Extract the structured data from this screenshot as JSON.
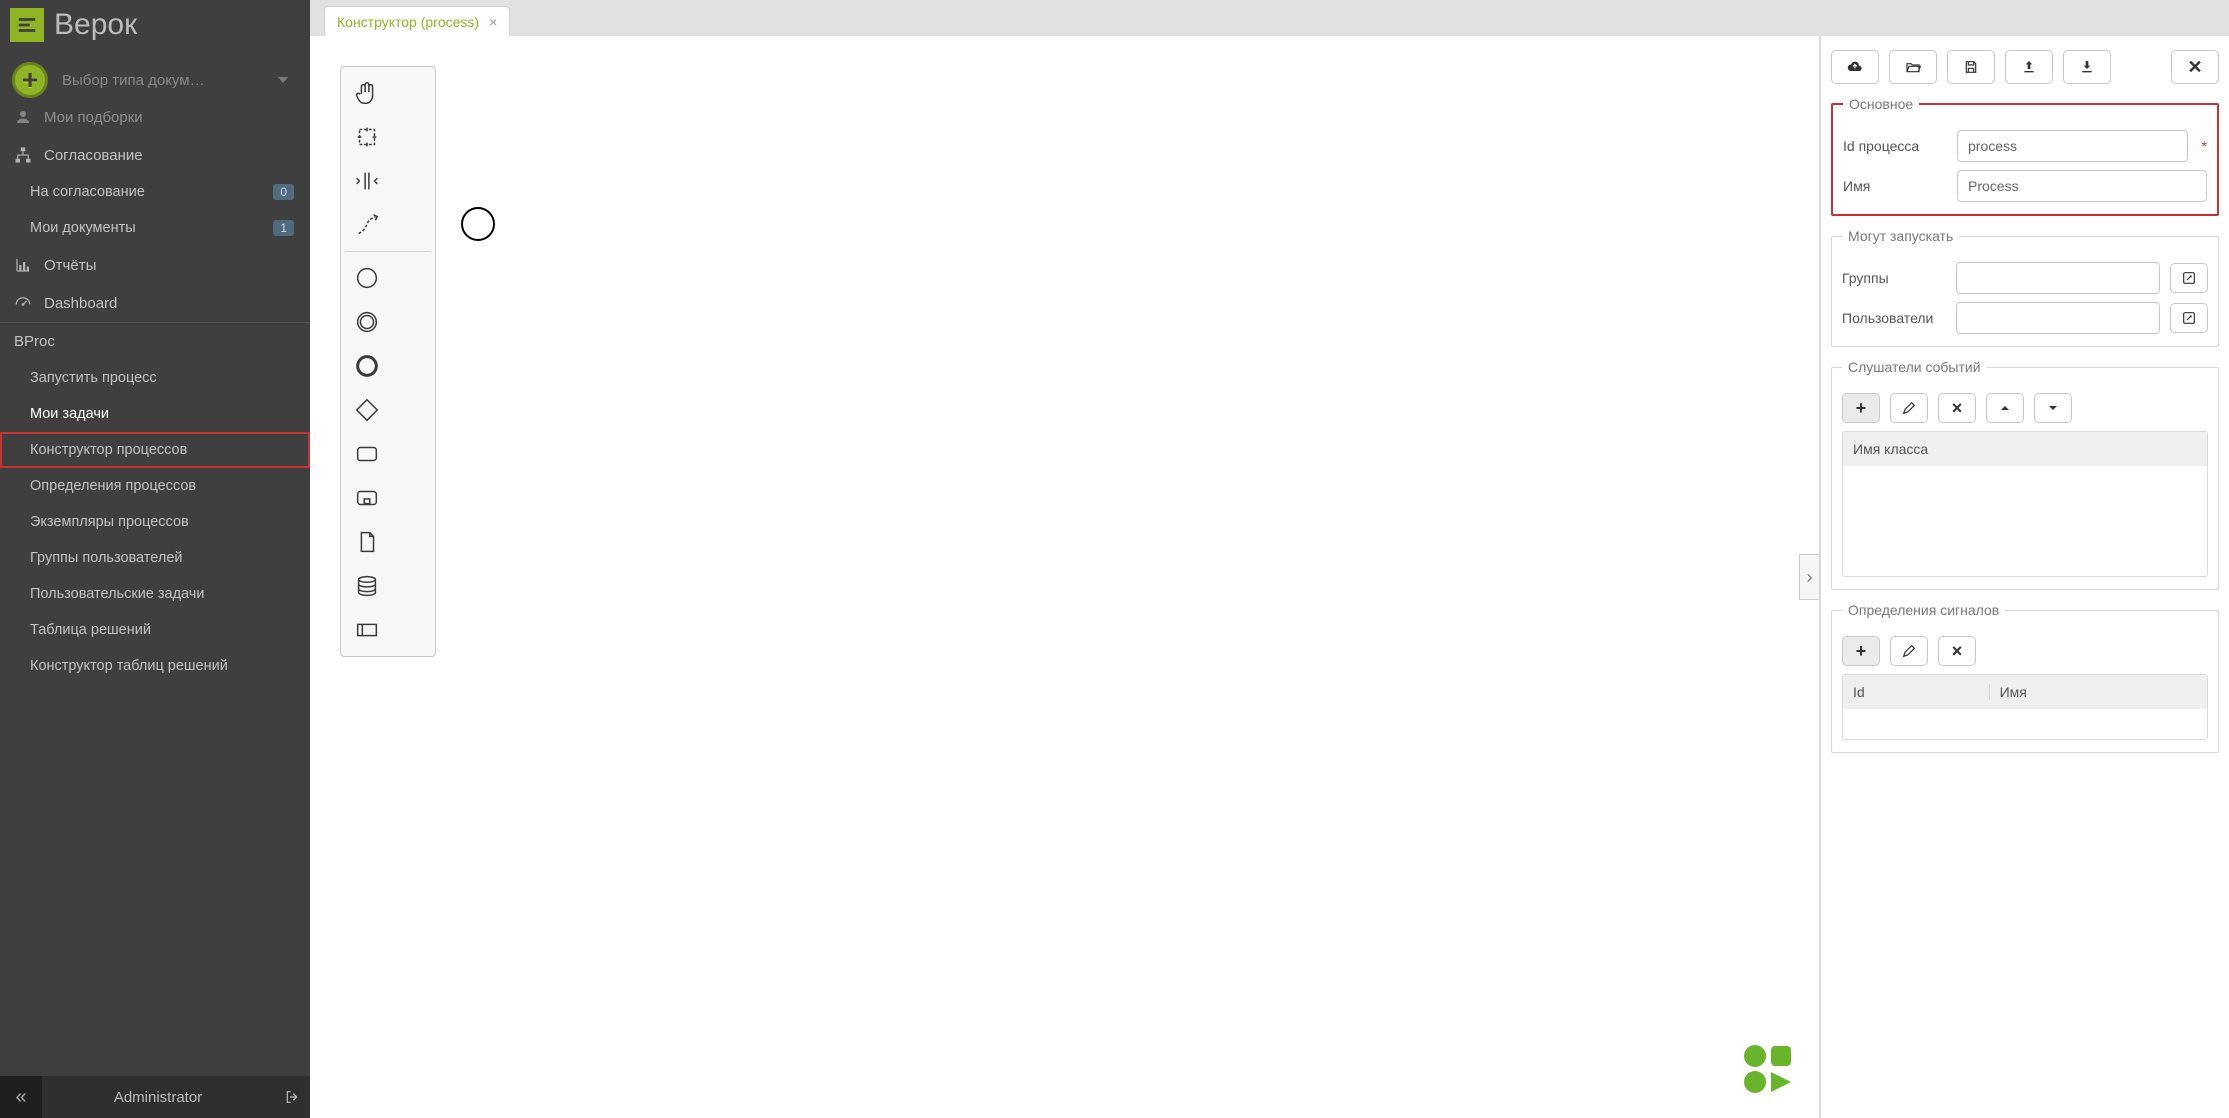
{
  "app": {
    "name": "Верок"
  },
  "doc_type_placeholder": "Выбор типа докум…",
  "sidebar": {
    "items": [
      {
        "label": "Мои подборки",
        "icon": "user"
      },
      {
        "label": "Согласование",
        "icon": "sitemap"
      },
      {
        "label": "На согласование",
        "sub": true,
        "badge": "0"
      },
      {
        "label": "Мои документы",
        "sub": true,
        "badge": "1"
      },
      {
        "label": "Отчёты",
        "icon": "chart"
      },
      {
        "label": "Dashboard",
        "icon": "gauge"
      }
    ],
    "bproc_header": "BProc",
    "bproc_items": [
      {
        "label": "Запустить процесс"
      },
      {
        "label": "Мои задачи",
        "active": true
      },
      {
        "label": "Конструктор процессов",
        "highlighted": true
      },
      {
        "label": "Определения процессов"
      },
      {
        "label": "Экземпляры процессов"
      },
      {
        "label": "Группы пользователей"
      },
      {
        "label": "Пользовательские задачи"
      },
      {
        "label": "Таблица решений"
      },
      {
        "label": "Конструктор таблиц решений"
      }
    ]
  },
  "footer": {
    "user": "Administrator"
  },
  "tab": {
    "title": "Конструктор (process)"
  },
  "props": {
    "main_legend": "Основное",
    "id_label": "Id процесса",
    "id_value": "process",
    "name_label": "Имя",
    "name_value": "Process",
    "launch_legend": "Могут запускать",
    "groups_label": "Группы",
    "users_label": "Пользователи",
    "listeners_legend": "Слушатели событий",
    "listeners_col": "Имя класса",
    "signals_legend": "Определения сигналов",
    "signals_cols": {
      "id": "Id",
      "name": "Имя"
    }
  }
}
